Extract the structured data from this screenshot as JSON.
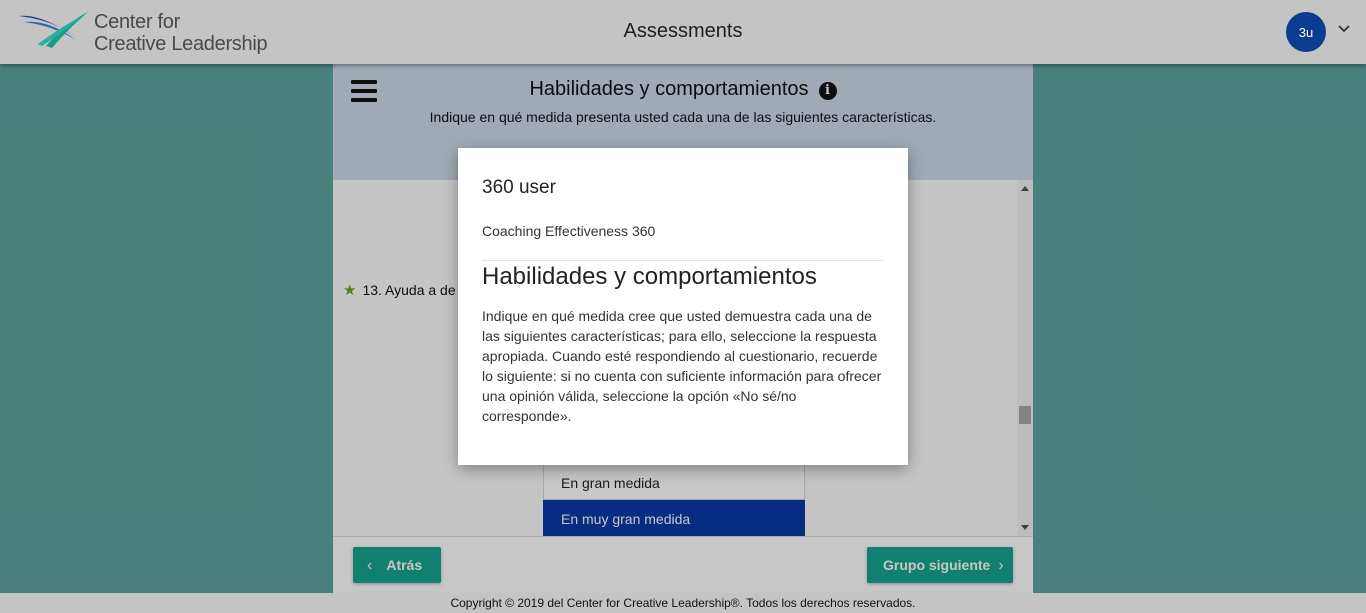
{
  "header": {
    "logo_line1": "Center for",
    "logo_line2": "Creative Leadership",
    "title": "Assessments",
    "avatar_initials": "3u"
  },
  "page": {
    "section_title": "Habilidades y comportamientos",
    "section_subtitle": "Indique en qué medida presenta usted cada una de las siguientes características.",
    "question": "13. Ayuda a de",
    "options": [
      {
        "label": "En gran medida",
        "selected": false
      },
      {
        "label": "En muy gran medida",
        "selected": true
      }
    ],
    "back_label": "Atrás",
    "next_label": "Grupo siguiente"
  },
  "modal": {
    "user": "360 user",
    "assessment": "Coaching Effectiveness 360",
    "title": "Habilidades y comportamientos",
    "body": "Indique en qué medida cree que usted demuestra cada una de las siguientes características; para ello, seleccione la respuesta apropiada. Cuando esté respondiendo al cuestionario, recuerde lo siguiente: si no cuenta con suficiente información para ofrecer una opinión válida, seleccione la opción «No sé/no corresponde»."
  },
  "footer": {
    "copyright": "Copyright © 2019 del Center for Creative Leadership®. Todos los derechos reservados."
  },
  "colors": {
    "teal_background": "#5fa59e",
    "button_teal": "#17a590",
    "selected_blue": "#0a3aa8",
    "avatar_blue": "#0a3d8f"
  }
}
